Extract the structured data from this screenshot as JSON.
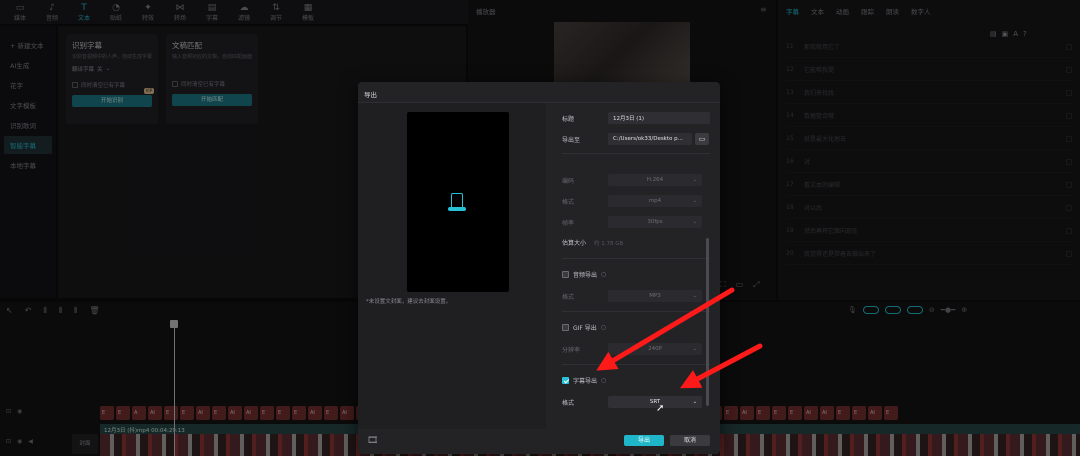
{
  "toolbar": {
    "tools": [
      {
        "label": "媒体",
        "icon": "media-icon"
      },
      {
        "label": "音频",
        "icon": "audio-icon"
      },
      {
        "label": "文本",
        "icon": "text-icon",
        "active": true
      },
      {
        "label": "贴纸",
        "icon": "sticker-icon"
      },
      {
        "label": "特效",
        "icon": "effects-icon"
      },
      {
        "label": "转场",
        "icon": "transition-icon"
      },
      {
        "label": "字幕",
        "icon": "caption-icon"
      },
      {
        "label": "滤镜",
        "icon": "filter-icon"
      },
      {
        "label": "调节",
        "icon": "adjust-icon"
      },
      {
        "label": "模板",
        "icon": "template-icon"
      }
    ]
  },
  "sidebar": {
    "items": [
      "+ 新建文本",
      "AI生成",
      "花字",
      "文字模板",
      "识别歌词",
      "智能字幕",
      "本地字幕"
    ],
    "active_index": 5
  },
  "cards": {
    "card1": {
      "title": "识别字幕",
      "desc": "识别音视频中的人声，自动生成字幕",
      "lang_label": "翻译字幕",
      "lang_value": "关",
      "check_label": "同时清空已有字幕",
      "button": "开始识别",
      "badge": "VIP"
    },
    "card2": {
      "title": "文稿匹配",
      "desc": "输入音频对应的文稿，自动匹配画面",
      "check_label": "同时清空已有字幕",
      "button": "开始匹配"
    }
  },
  "player": {
    "title": "播放器",
    "menu": "≡"
  },
  "right_panel": {
    "tabs": [
      "字幕",
      "文本",
      "动画",
      "跟踪",
      "朗读",
      "数字人"
    ],
    "active_tab": 0,
    "rows": [
      {
        "n": "11",
        "text": "那我就用它了"
      },
      {
        "n": "12",
        "text": "它能帮我提"
      },
      {
        "n": "13",
        "text": "我们来找找"
      },
      {
        "n": "14",
        "text": "数据整合哦"
      },
      {
        "n": "15",
        "text": "就是最大化地去"
      },
      {
        "n": "16",
        "text": "对"
      },
      {
        "n": "17",
        "text": "看文本的编辑"
      },
      {
        "n": "18",
        "text": "对以后"
      },
      {
        "n": "19",
        "text": "然后再将它面向现在"
      },
      {
        "n": "20",
        "text": "我觉得还是带着去做出来了"
      }
    ]
  },
  "timeline": {
    "video_clip": "12月3日 (抖)mp4  00:04:29:13",
    "cover_label": "封面",
    "sub_clips": [
      "E",
      "E",
      "A",
      "AI",
      "E",
      "E",
      "AI",
      "E",
      "AI",
      "AI",
      "E",
      "E",
      "E",
      "AI",
      "E",
      "AI",
      "E",
      "AI",
      "AI",
      "E",
      "E",
      "AI",
      "E",
      "E",
      "AI",
      "AI",
      "E",
      "E",
      "E",
      "AI",
      "E",
      "AI",
      "E",
      "E",
      "AI",
      "E",
      "E",
      "AI",
      "E",
      "E",
      "AI",
      "E",
      "E",
      "E",
      "AI",
      "AI",
      "E",
      "E",
      "AI",
      "E"
    ]
  },
  "dialog": {
    "title": "导出",
    "preview_note": "*未设置文封面，建议去封面设置。",
    "fields": {
      "title_label": "标题",
      "title_value": "12月3日 (1)",
      "path_label": "导出至",
      "path_value": "C:/Users/ok33/Deskto p...",
      "codec_label": "编码",
      "codec_value": "H.264",
      "format_label": "格式",
      "format_value": "mp4",
      "fps_label": "帧率",
      "fps_value": "30fps",
      "estimate_label": "估算大小",
      "estimate_value": "约 1.78 GB"
    },
    "audio_section": {
      "label": "音频导出",
      "format_label": "格式",
      "format_value": "MP3"
    },
    "gif_section": {
      "label": "GIF 导出",
      "res_label": "分辨率",
      "res_value": "240P"
    },
    "caption_section": {
      "label": "字幕导出",
      "format_label": "格式",
      "format_value": "SRT"
    },
    "export_button": "导出",
    "cancel_button": "取消"
  },
  "colors": {
    "accent": "#27c2d8",
    "arrow": "#ff1a1a"
  }
}
